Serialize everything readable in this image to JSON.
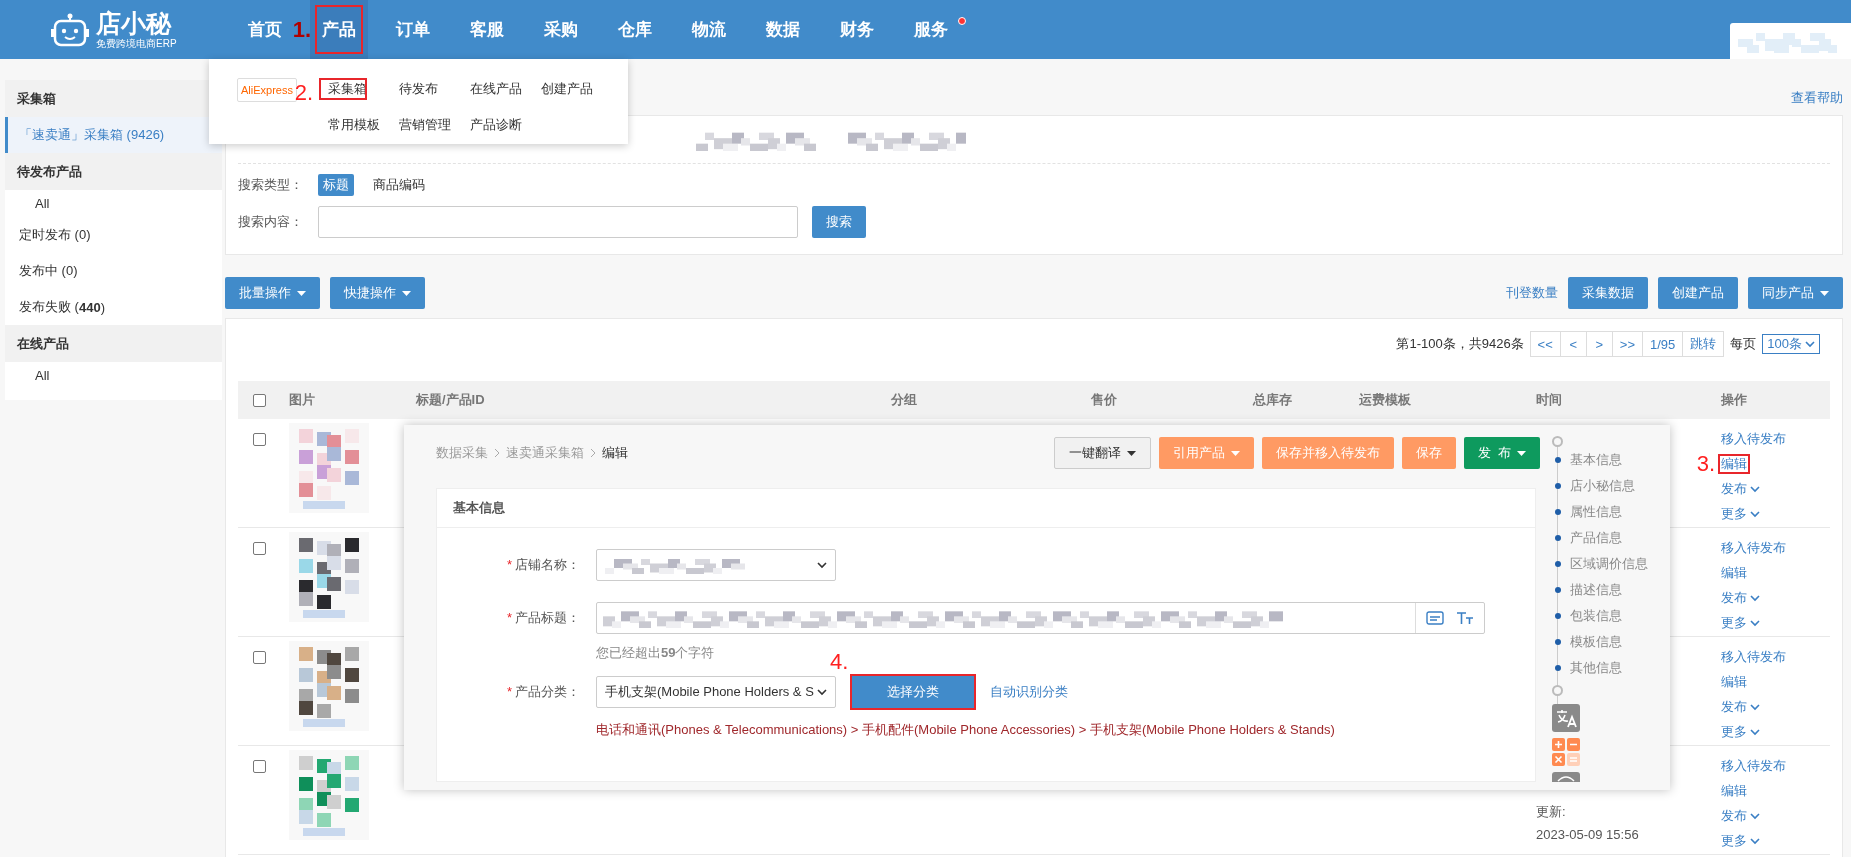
{
  "header": {
    "logo_name": "店小秘",
    "logo_tagline": "免费跨境电商ERP",
    "nav": [
      {
        "label": "首页",
        "selected": false,
        "highlighted": false,
        "badge": false
      },
      {
        "label": "产品",
        "selected": true,
        "highlighted": true,
        "marker": "1.",
        "badge": false
      },
      {
        "label": "订单",
        "selected": false,
        "highlighted": false,
        "badge": false
      },
      {
        "label": "客服",
        "selected": false,
        "highlighted": false,
        "badge": false
      },
      {
        "label": "采购",
        "selected": false,
        "highlighted": false,
        "badge": false
      },
      {
        "label": "仓库",
        "selected": false,
        "highlighted": false,
        "badge": false
      },
      {
        "label": "物流",
        "selected": false,
        "highlighted": false,
        "badge": false
      },
      {
        "label": "数据",
        "selected": false,
        "highlighted": false,
        "badge": false
      },
      {
        "label": "财务",
        "selected": false,
        "highlighted": false,
        "badge": false
      },
      {
        "label": "服务",
        "selected": false,
        "highlighted": false,
        "badge": true
      }
    ]
  },
  "product_menu": {
    "platform": "AliExpress",
    "items": [
      {
        "label": "采集箱",
        "highlighted": true,
        "marker": "2."
      },
      {
        "label": "待发布",
        "highlighted": false
      },
      {
        "label": "在线产品",
        "highlighted": false
      },
      {
        "label": "创建产品",
        "highlighted": false
      },
      {
        "label": "常用模板",
        "highlighted": false
      },
      {
        "label": "营销管理",
        "highlighted": false
      },
      {
        "label": "产品诊断",
        "highlighted": false
      }
    ]
  },
  "sidebar": {
    "sections": [
      {
        "title": "采集箱",
        "items": [
          {
            "label": "「速卖通」采集箱 (9426)",
            "kind": "item",
            "selected": true
          }
        ]
      },
      {
        "title": "待发布产品",
        "items": [
          {
            "label": "All",
            "kind": "subitem",
            "selected": false
          },
          {
            "label": "定时发布 (0)",
            "kind": "item",
            "selected": false
          },
          {
            "label": "发布中 (0)",
            "kind": "item",
            "selected": false
          },
          {
            "label": "发布失败 (**440**)",
            "kind": "item",
            "selected": false
          }
        ]
      },
      {
        "title": "在线产品",
        "items": [
          {
            "label": "All",
            "kind": "subitem",
            "selected": false
          }
        ]
      }
    ]
  },
  "help_link": "查看帮助",
  "filters": {
    "search_type_label": "搜索类型：",
    "search_types": [
      {
        "label": "标题",
        "selected": true
      },
      {
        "label": "商品编码",
        "selected": false
      }
    ],
    "search_label": "搜索内容：",
    "search_button": "搜索"
  },
  "toolbar": {
    "left": [
      {
        "label": "批量操作",
        "dropdown": true
      },
      {
        "label": "快捷操作",
        "dropdown": true
      }
    ],
    "link": "刊登数量",
    "right": [
      {
        "label": "采集数据",
        "dropdown": false
      },
      {
        "label": "创建产品",
        "dropdown": false
      },
      {
        "label": "同步产品",
        "dropdown": true
      }
    ]
  },
  "pagination": {
    "summary": "第1-100条，共9426条",
    "buttons": [
      "<<",
      "<",
      ">",
      ">>",
      "1/95",
      "跳转"
    ],
    "per_page_label": "每页",
    "per_page": "100条"
  },
  "table": {
    "all_checked": false,
    "columns": [
      "图片",
      "标题/产品ID",
      "分组",
      "售价",
      "总库存",
      "运费模板",
      "时间",
      "操作"
    ],
    "rows": [
      {
        "checked": false,
        "time": [],
        "actions": [
          {
            "label": "移入待发布",
            "dropdown": false,
            "highlighted": false
          },
          {
            "label": "编辑",
            "dropdown": false,
            "highlighted": true,
            "marker": "3."
          },
          {
            "label": "发布",
            "dropdown": true,
            "highlighted": false
          },
          {
            "label": "更多",
            "dropdown": true,
            "highlighted": false
          }
        ]
      },
      {
        "checked": false,
        "time": [],
        "actions": [
          {
            "label": "移入待发布",
            "dropdown": false,
            "highlighted": false
          },
          {
            "label": "编辑",
            "dropdown": false,
            "highlighted": false
          },
          {
            "label": "发布",
            "dropdown": true,
            "highlighted": false
          },
          {
            "label": "更多",
            "dropdown": true,
            "highlighted": false
          }
        ]
      },
      {
        "checked": false,
        "time": [],
        "actions": [
          {
            "label": "移入待发布",
            "dropdown": false,
            "highlighted": false
          },
          {
            "label": "编辑",
            "dropdown": false,
            "highlighted": false
          },
          {
            "label": "发布",
            "dropdown": true,
            "highlighted": false
          },
          {
            "label": "更多",
            "dropdown": true,
            "highlighted": false
          }
        ]
      },
      {
        "checked": false,
        "time": [
          "更新:",
          "2023-05-09 15:56"
        ],
        "actions": [
          {
            "label": "移入待发布",
            "dropdown": false,
            "highlighted": false
          },
          {
            "label": "编辑",
            "dropdown": false,
            "highlighted": false
          },
          {
            "label": "发布",
            "dropdown": true,
            "highlighted": false
          },
          {
            "label": "更多",
            "dropdown": true,
            "highlighted": false
          }
        ]
      }
    ]
  },
  "editor": {
    "breadcrumb": [
      {
        "label": "数据采集",
        "current": false
      },
      {
        "label": "速卖通采集箱",
        "current": false
      },
      {
        "label": "编辑",
        "current": true
      }
    ],
    "buttons": [
      {
        "label": "一键翻译",
        "kind": "default",
        "dropdown": true
      },
      {
        "label": "引用产品",
        "kind": "warning",
        "dropdown": true
      },
      {
        "label": "保存并移入待发布",
        "kind": "warning",
        "dropdown": false
      },
      {
        "label": "保存",
        "kind": "warning",
        "dropdown": false
      },
      {
        "label": "发  布",
        "kind": "success",
        "dropdown": true
      }
    ],
    "section_title": "基本信息",
    "fields": [
      {
        "kind": "store",
        "mark": "*",
        "label": "店铺名称："
      },
      {
        "kind": "title",
        "mark": "*",
        "label": "产品标题：",
        "hint": "您已经超出**59**个字符"
      },
      {
        "kind": "category",
        "mark": "*",
        "label": "产品分类：",
        "value": "手机支架(Mobile Phone Holders & S",
        "button": "选择分类",
        "button_highlighted": true,
        "marker": "4.",
        "link": "自动识别分类",
        "path": "电话和通讯(Phones & Telecommunications) > 手机配件(Mobile Phone Accessories) > 手机支架(Mobile Phone Holders & Stands)"
      }
    ],
    "nav": [
      "基本信息",
      "店小秘信息",
      "属性信息",
      "产品信息",
      "区域调价信息",
      "描述信息",
      "包装信息",
      "模板信息",
      "其他信息"
    ]
  }
}
